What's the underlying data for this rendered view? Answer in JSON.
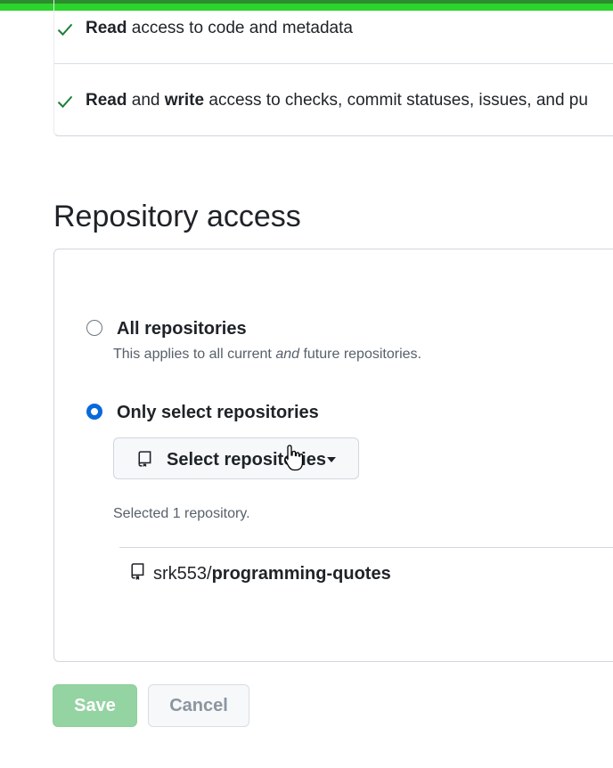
{
  "permissions": {
    "row1": {
      "bold": "Read",
      "rest": " access to code and metadata"
    },
    "row2": {
      "bold1": "Read",
      "mid": " and ",
      "bold2": "write",
      "rest": " access to checks, commit statuses, issues, and pu"
    }
  },
  "section": {
    "title": "Repository access"
  },
  "options": {
    "all": {
      "label": "All repositories",
      "note_before": "This applies to all current ",
      "note_em": "and",
      "note_after": " future repositories.",
      "selected": false
    },
    "only": {
      "label": "Only select repositories",
      "selected": true
    }
  },
  "select_button": {
    "label": "Select repositories",
    "icon": "repo-icon"
  },
  "selected_count": "Selected 1 repository.",
  "repos": [
    {
      "owner": "srk553/",
      "name": "programming-quotes",
      "icon": "repo-icon"
    }
  ],
  "actions": {
    "save": "Save",
    "cancel": "Cancel"
  },
  "colors": {
    "accent": "#0969da",
    "save_disabled": "#94d3a2",
    "top_bar": "#2bd52b"
  }
}
